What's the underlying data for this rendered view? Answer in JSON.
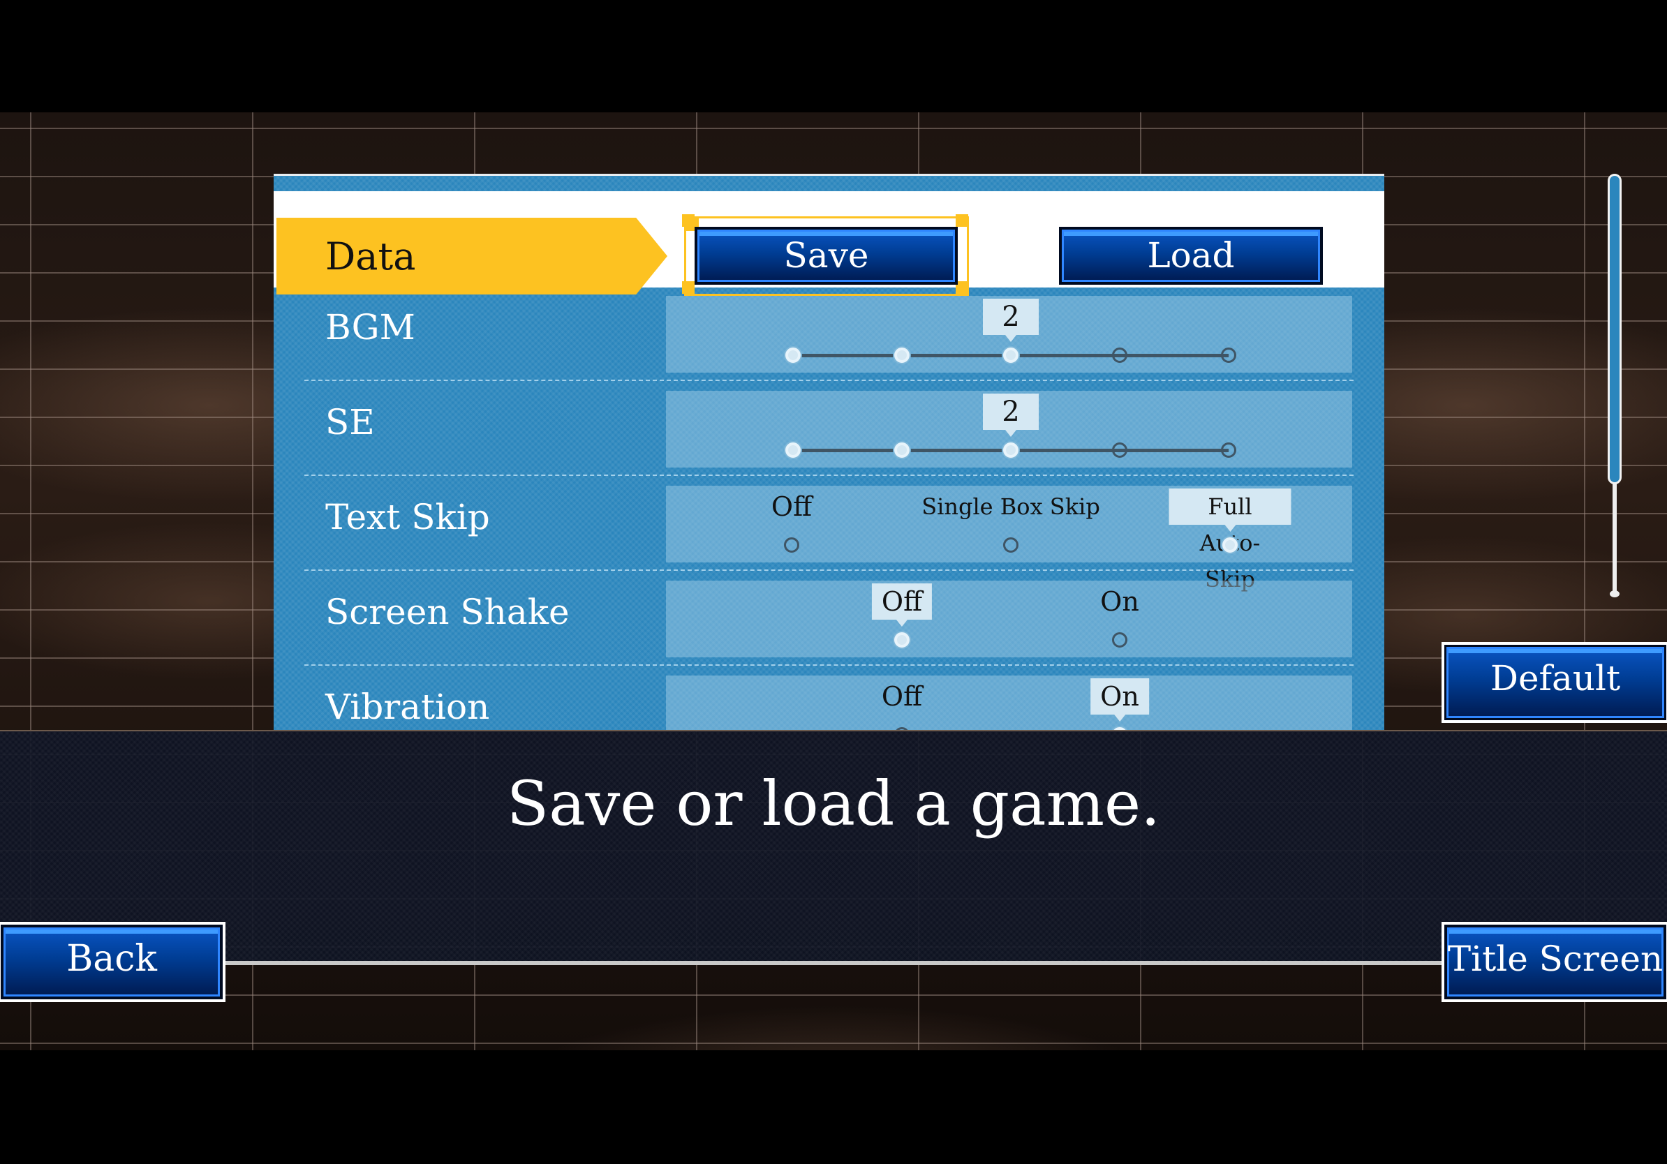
{
  "screen": "options",
  "header": {
    "category_label": "Data",
    "save_label": "Save",
    "load_label": "Load",
    "focused_button": "Save"
  },
  "settings": [
    {
      "label": "BGM",
      "type": "slider",
      "levels": [
        0,
        1,
        2,
        3,
        4
      ],
      "value": 2,
      "value_text": "2"
    },
    {
      "label": "SE",
      "type": "slider",
      "levels": [
        0,
        1,
        2,
        3,
        4
      ],
      "value": 2,
      "value_text": "2"
    },
    {
      "label": "Text Skip",
      "type": "choice",
      "options": [
        "Off",
        "Single Box Skip",
        "Full Auto-Skip"
      ],
      "selected": "Full Auto-Skip"
    },
    {
      "label": "Screen Shake",
      "type": "choice",
      "options": [
        "Off",
        "On"
      ],
      "selected": "Off"
    },
    {
      "label": "Vibration",
      "type": "choice",
      "options": [
        "Off",
        "On"
      ],
      "selected": "On"
    }
  ],
  "scrollbar": {
    "position_fraction": 0.0,
    "visible_fraction": 0.74
  },
  "buttons": {
    "default_label": "Default",
    "back_label": "Back",
    "title_screen_label": "Title Screen"
  },
  "message": "Save or load a game.",
  "colors": {
    "panel_blue": "#2b86bd",
    "highlight_yellow": "#fdc221",
    "button_blue": "#003d94",
    "bubble": "#d5e8f3"
  }
}
